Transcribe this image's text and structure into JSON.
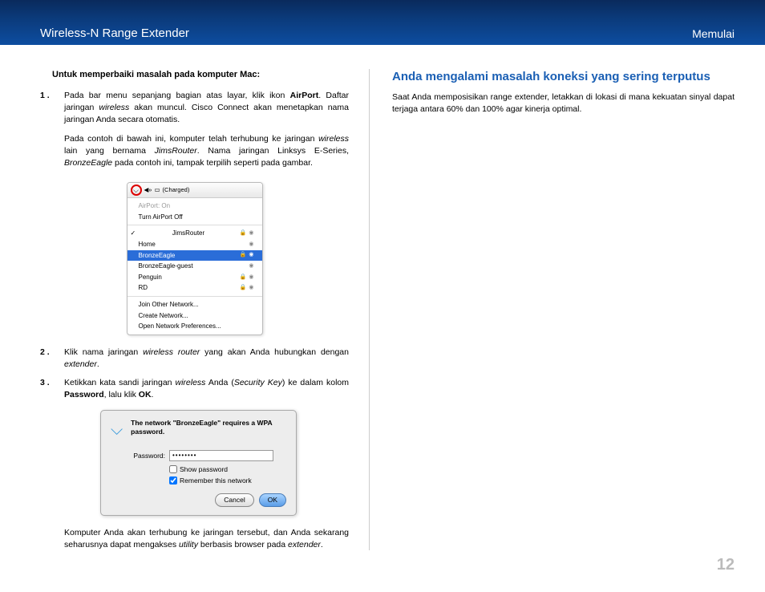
{
  "header": {
    "left": "Wireless-N Range Extender",
    "right": "Memulai"
  },
  "left_col": {
    "sub_heading": "Untuk memperbaiki masalah pada komputer Mac:",
    "step1": {
      "num": "1 .",
      "p1_a": "Pada bar menu sepanjang bagian atas layar, klik ikon ",
      "p1_b": "AirPort",
      "p1_c": ". Daftar jaringan ",
      "p1_d": "wireless",
      "p1_e": " akan muncul. Cisco Connect akan menetapkan nama jaringan Anda secara otomatis.",
      "p2_a": "Pada contoh di bawah ini, komputer telah terhubung ke jaringan ",
      "p2_b": "wireless",
      "p2_c": " lain yang bernama ",
      "p2_d": "JimsRouter",
      "p2_e": ". Nama jaringan Linksys E-Series, ",
      "p2_f": "BronzeEagle",
      "p2_g": " pada contoh ini, tampak terpilih seperti pada gambar."
    },
    "airport": {
      "top_status": "(Charged)",
      "on_label": "AirPort: On",
      "turn_off": "Turn AirPort Off",
      "net1": "JimsRouter",
      "net2": "Home",
      "net3": "BronzeEagle",
      "net4": "BronzeEagle-guest",
      "net5": "Penguin",
      "net6": "RD",
      "join": "Join Other Network...",
      "create": "Create Network...",
      "prefs": "Open Network Preferences..."
    },
    "step2": {
      "num": "2 .",
      "a": "Klik nama jaringan ",
      "b": "wireless router",
      "c": " yang akan Anda hubungkan dengan ",
      "d": "extender",
      "e": "."
    },
    "step3": {
      "num": "3 .",
      "a": "Ketikkan kata sandi jaringan ",
      "b": "wireless",
      "c": " Anda (",
      "d": "Security Key",
      "e": ") ke dalam kolom ",
      "f": "Password",
      "g": ", lalu klik ",
      "h": "OK",
      "i": "."
    },
    "dialog": {
      "msg": "The network \"BronzeEagle\" requires a WPA password.",
      "pw_label": "Password:",
      "pw_value": "••••••••",
      "show": "Show password",
      "remember": "Remember this network",
      "cancel": "Cancel",
      "ok": "OK"
    },
    "closing": {
      "a": "Komputer Anda akan terhubung ke jaringan tersebut, dan Anda sekarang seharusnya dapat mengakses ",
      "b": "utility",
      "c": " berbasis browser pada ",
      "d": "extender",
      "e": "."
    }
  },
  "right_col": {
    "title": "Anda mengalami masalah koneksi yang sering terputus",
    "body": "Saat Anda memposisikan range extender, letakkan di lokasi di mana kekuatan sinyal dapat terjaga antara 60% dan 100% agar kinerja optimal."
  },
  "page_num": "12"
}
